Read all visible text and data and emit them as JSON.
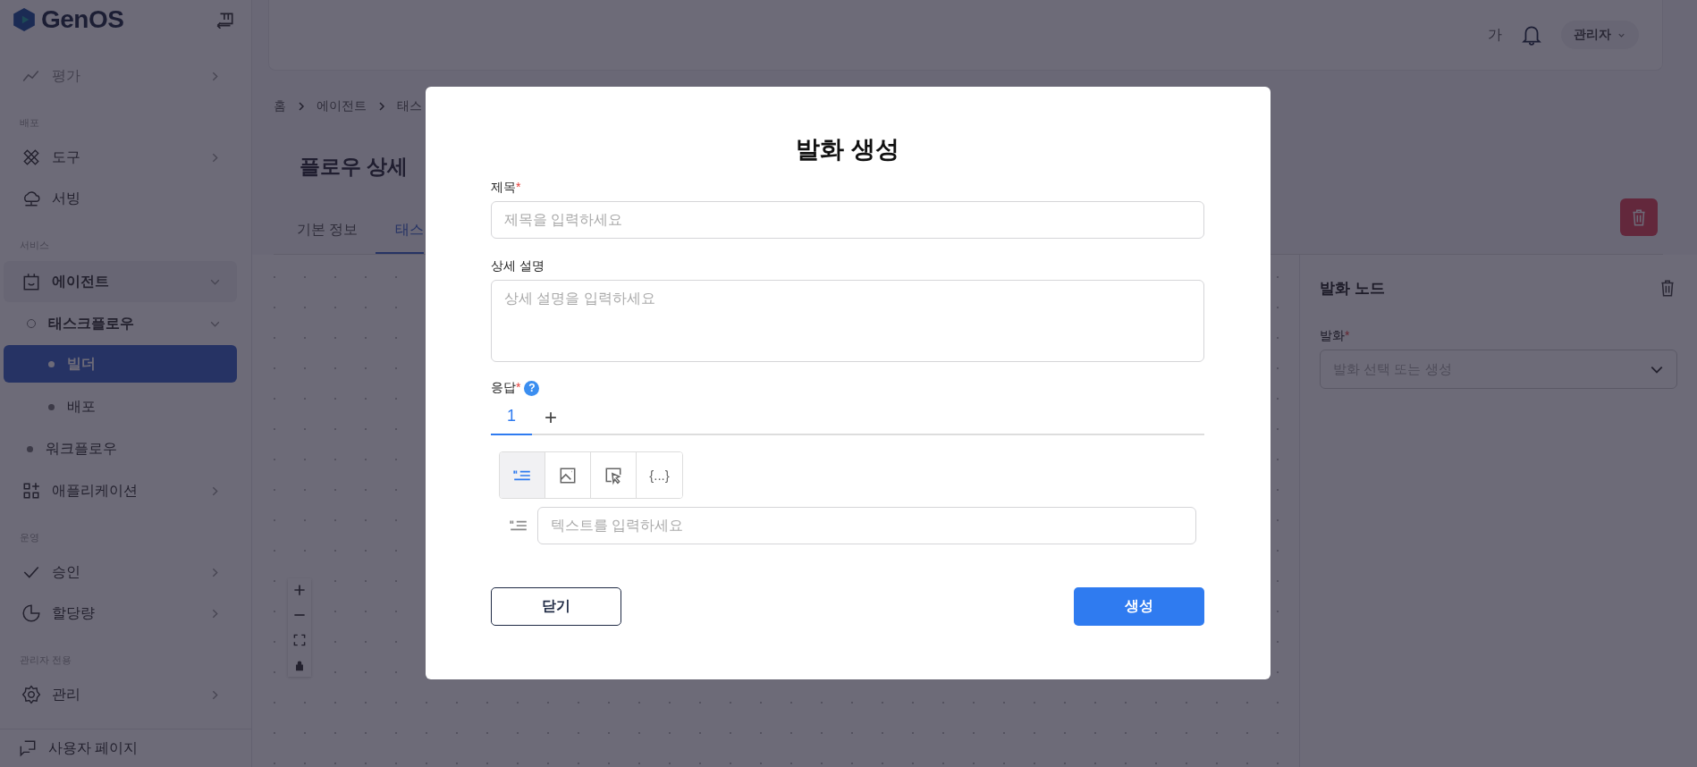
{
  "sidebar": {
    "logo": "GenOS",
    "groups": [
      {
        "items": [
          {
            "label": "평가",
            "expanded": false,
            "disabled": true
          }
        ]
      },
      {
        "heading": "배포",
        "items": [
          {
            "label": "도구",
            "expanded": false,
            "disabled": false
          },
          {
            "label": "서빙",
            "disabled": false
          }
        ]
      },
      {
        "heading": "서비스",
        "items": [
          {
            "label": "에이전트",
            "disabled": false,
            "expanded": true,
            "children": [
              {
                "label": "태스크플로우",
                "expanded": true,
                "children": [
                  {
                    "label": "빌더",
                    "selected": true
                  },
                  {
                    "label": "배포",
                    "selected": false
                  }
                ]
              },
              {
                "label": "워크플로우"
              }
            ]
          },
          {
            "label": "애플리케이션",
            "expanded": false,
            "disabled": false
          }
        ]
      },
      {
        "heading": "운영",
        "items": [
          {
            "label": "승인",
            "expanded": false,
            "disabled": false
          },
          {
            "label": "할당량",
            "expanded": false,
            "disabled": false
          }
        ]
      },
      {
        "heading": "관리자 전용",
        "items": [
          {
            "label": "관리",
            "expanded": false,
            "disabled": false
          }
        ]
      }
    ],
    "footer": {
      "label": "사용자 페이지"
    }
  },
  "header": {
    "font_button": "가",
    "user": "관리자"
  },
  "breadcrumb": [
    "홈",
    "에이전트",
    "태스"
  ],
  "page_title": "플로우 상세",
  "tabs": [
    {
      "label": "기본 정보",
      "selected": false
    },
    {
      "label": "태스",
      "selected": true
    }
  ],
  "side_panel": {
    "title": "발화 노드",
    "field": {
      "label": "발화",
      "required_mark": "*",
      "placeholder": "발화 선택 또는 생성"
    }
  },
  "modal": {
    "title": "발화 생성",
    "fields": [
      {
        "kind": "input",
        "label": "제목",
        "required_mark": "*",
        "placeholder": "제목을 입력하세요"
      },
      {
        "kind": "textarea",
        "label": "상세 설명",
        "placeholder": "상세 설명을 입력하세요"
      }
    ],
    "response": {
      "label": "응답",
      "required_mark": "*",
      "help": "?",
      "tabs": [
        {
          "label": "1",
          "selected": true
        }
      ],
      "add": "+",
      "tools": [
        {
          "kind": "text",
          "selected": true
        },
        {
          "kind": "image",
          "selected": false
        },
        {
          "kind": "pointer",
          "selected": false
        },
        {
          "kind": "variable",
          "label": "{...}",
          "selected": false
        }
      ],
      "text_placeholder": "텍스트를 입력하세요"
    },
    "buttons": [
      {
        "kind": "secondary",
        "label": "닫기"
      },
      {
        "kind": "primary",
        "label": "생성"
      }
    ]
  }
}
